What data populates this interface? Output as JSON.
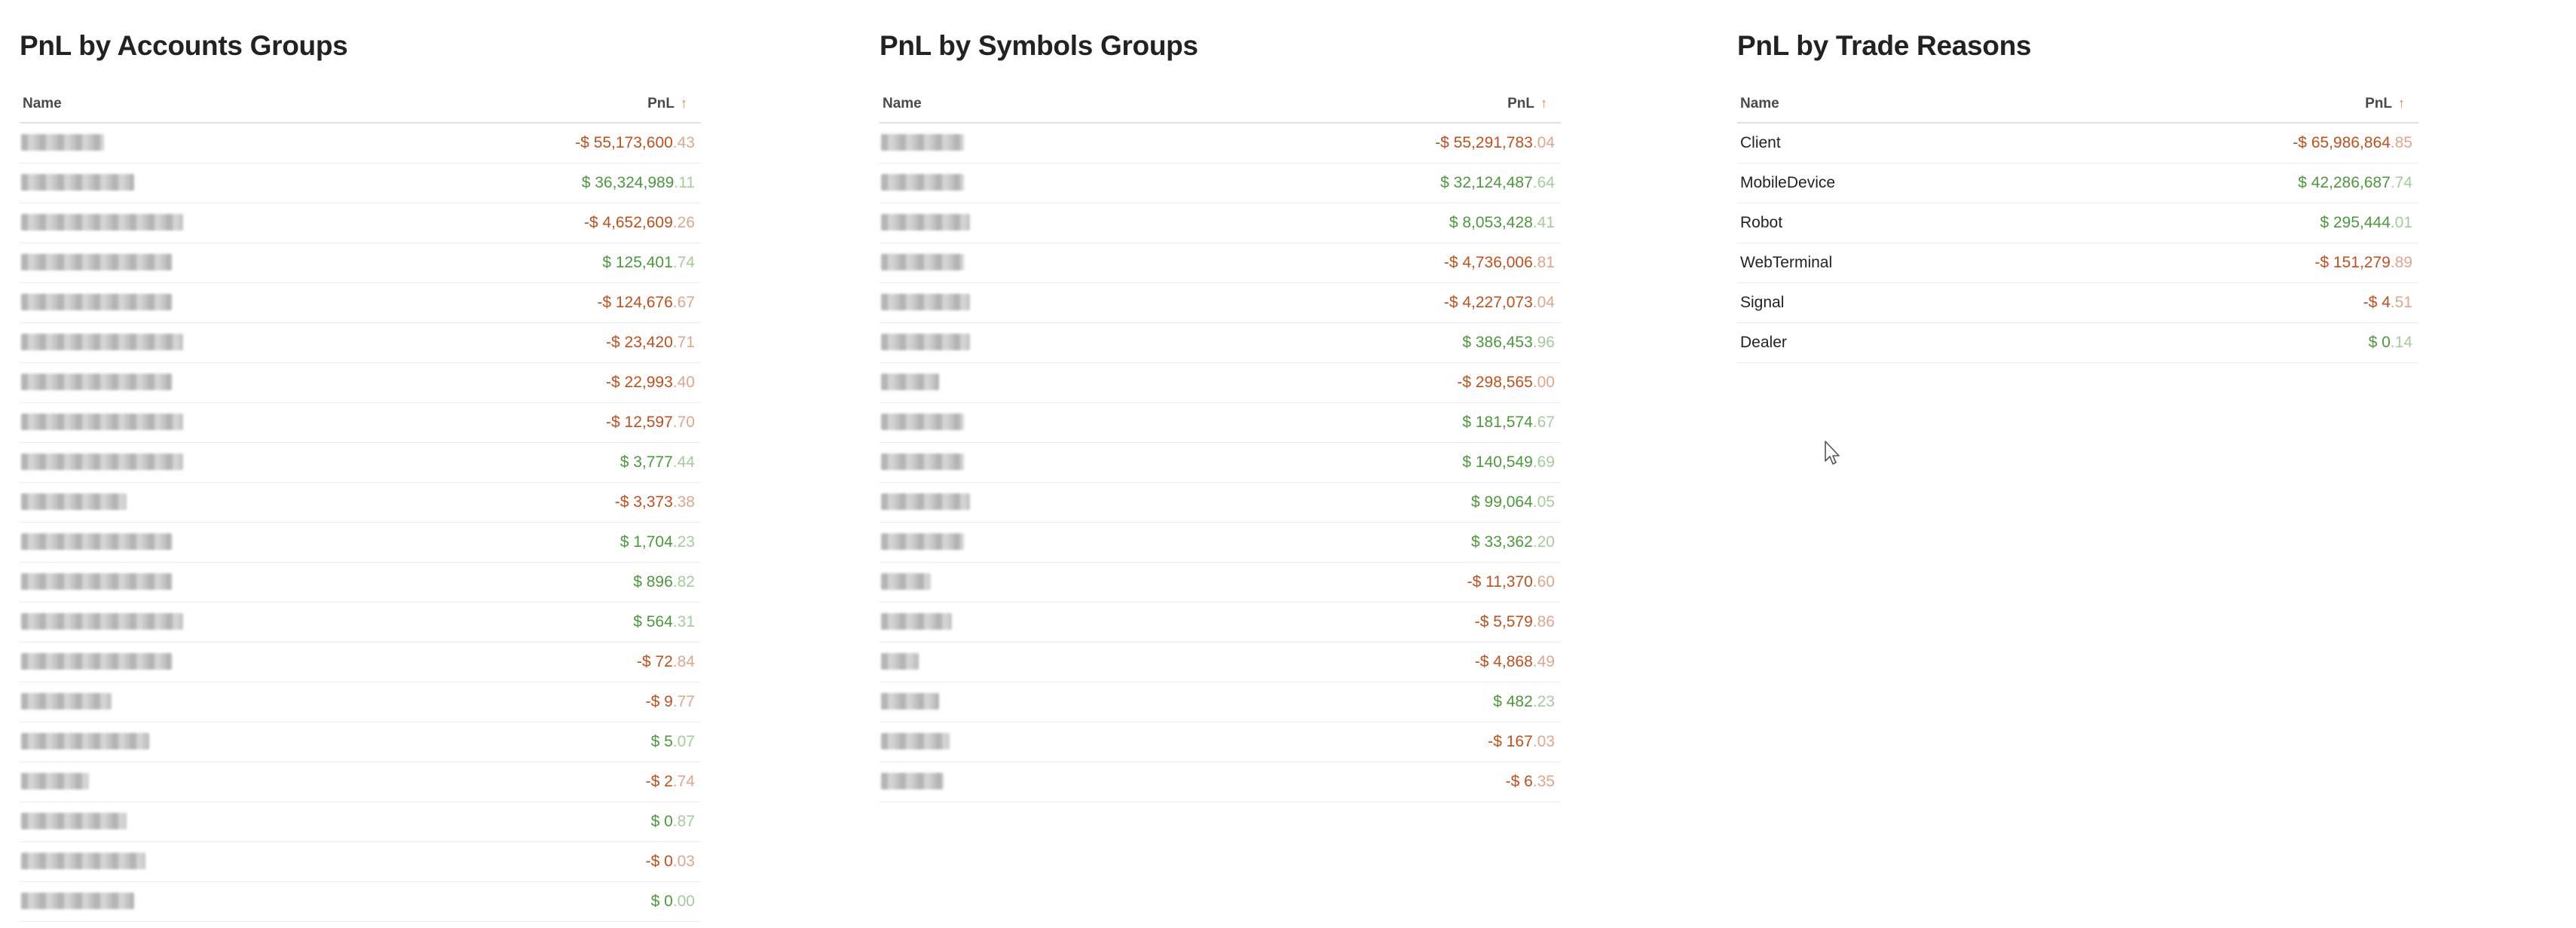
{
  "panels": [
    {
      "id": "accounts",
      "title": "PnL by Accounts Groups",
      "col_name": "Name",
      "col_pnl": "PnL",
      "sort_icon": "↑",
      "redacted_names": true,
      "rows": [
        {
          "sign": "neg",
          "int": "-$ 55,173,600",
          "frac": ".43"
        },
        {
          "sign": "pos",
          "int": "$ 36,324,989",
          "frac": ".11"
        },
        {
          "sign": "neg",
          "int": "-$ 4,652,609",
          "frac": ".26"
        },
        {
          "sign": "pos",
          "int": "$ 125,401",
          "frac": ".74"
        },
        {
          "sign": "neg",
          "int": "-$ 124,676",
          "frac": ".67"
        },
        {
          "sign": "neg",
          "int": "-$ 23,420",
          "frac": ".71"
        },
        {
          "sign": "neg",
          "int": "-$ 22,993",
          "frac": ".40"
        },
        {
          "sign": "neg",
          "int": "-$ 12,597",
          "frac": ".70"
        },
        {
          "sign": "pos",
          "int": "$ 3,777",
          "frac": ".44"
        },
        {
          "sign": "neg",
          "int": "-$ 3,373",
          "frac": ".38"
        },
        {
          "sign": "pos",
          "int": "$ 1,704",
          "frac": ".23"
        },
        {
          "sign": "pos",
          "int": "$ 896",
          "frac": ".82"
        },
        {
          "sign": "pos",
          "int": "$ 564",
          "frac": ".31"
        },
        {
          "sign": "neg",
          "int": "-$ 72",
          "frac": ".84"
        },
        {
          "sign": "neg",
          "int": "-$ 9",
          "frac": ".77"
        },
        {
          "sign": "pos",
          "int": "$ 5",
          "frac": ".07"
        },
        {
          "sign": "neg",
          "int": "-$ 2",
          "frac": ".74"
        },
        {
          "sign": "pos",
          "int": "$ 0",
          "frac": ".87"
        },
        {
          "sign": "neg",
          "int": "-$ 0",
          "frac": ".03"
        },
        {
          "sign": "pos",
          "int": "$ 0",
          "frac": ".00"
        }
      ]
    },
    {
      "id": "symbols",
      "title": "PnL by Symbols Groups",
      "col_name": "Name",
      "col_pnl": "PnL",
      "sort_icon": "↑",
      "redacted_names": true,
      "rows": [
        {
          "sign": "neg",
          "int": "-$ 55,291,783",
          "frac": ".04"
        },
        {
          "sign": "pos",
          "int": "$ 32,124,487",
          "frac": ".64"
        },
        {
          "sign": "pos",
          "int": "$ 8,053,428",
          "frac": ".41"
        },
        {
          "sign": "neg",
          "int": "-$ 4,736,006",
          "frac": ".81"
        },
        {
          "sign": "neg",
          "int": "-$ 4,227,073",
          "frac": ".04"
        },
        {
          "sign": "pos",
          "int": "$ 386,453",
          "frac": ".96"
        },
        {
          "sign": "neg",
          "int": "-$ 298,565",
          "frac": ".00"
        },
        {
          "sign": "pos",
          "int": "$ 181,574",
          "frac": ".67"
        },
        {
          "sign": "pos",
          "int": "$ 140,549",
          "frac": ".69"
        },
        {
          "sign": "pos",
          "int": "$ 99,064",
          "frac": ".05"
        },
        {
          "sign": "pos",
          "int": "$ 33,362",
          "frac": ".20"
        },
        {
          "sign": "neg",
          "int": "-$ 11,370",
          "frac": ".60"
        },
        {
          "sign": "neg",
          "int": "-$ 5,579",
          "frac": ".86"
        },
        {
          "sign": "neg",
          "int": "-$ 4,868",
          "frac": ".49"
        },
        {
          "sign": "pos",
          "int": "$ 482",
          "frac": ".23"
        },
        {
          "sign": "neg",
          "int": "-$ 167",
          "frac": ".03"
        },
        {
          "sign": "neg",
          "int": "-$ 6",
          "frac": ".35"
        }
      ]
    },
    {
      "id": "reasons",
      "title": "PnL by Trade Reasons",
      "col_name": "Name",
      "col_pnl": "PnL",
      "sort_icon": "↑",
      "redacted_names": false,
      "rows": [
        {
          "name": "Client",
          "sign": "neg",
          "int": "-$ 65,986,864",
          "frac": ".85"
        },
        {
          "name": "MobileDevice",
          "sign": "pos",
          "int": "$ 42,286,687",
          "frac": ".74"
        },
        {
          "name": "Robot",
          "sign": "pos",
          "int": "$ 295,444",
          "frac": ".01"
        },
        {
          "name": "WebTerminal",
          "sign": "neg",
          "int": "-$ 151,279",
          "frac": ".89"
        },
        {
          "name": "Signal",
          "sign": "neg",
          "int": "-$ 4",
          "frac": ".51"
        },
        {
          "name": "Dealer",
          "sign": "pos",
          "int": "$ 0",
          "frac": ".14"
        }
      ]
    }
  ],
  "colors": {
    "negative": "#c0501c",
    "positive": "#4a9a3a",
    "sort_icon": "#e08a3a"
  },
  "icons": {
    "sort": "sort-ascending-icon",
    "cursor": "mouse-pointer-icon"
  }
}
